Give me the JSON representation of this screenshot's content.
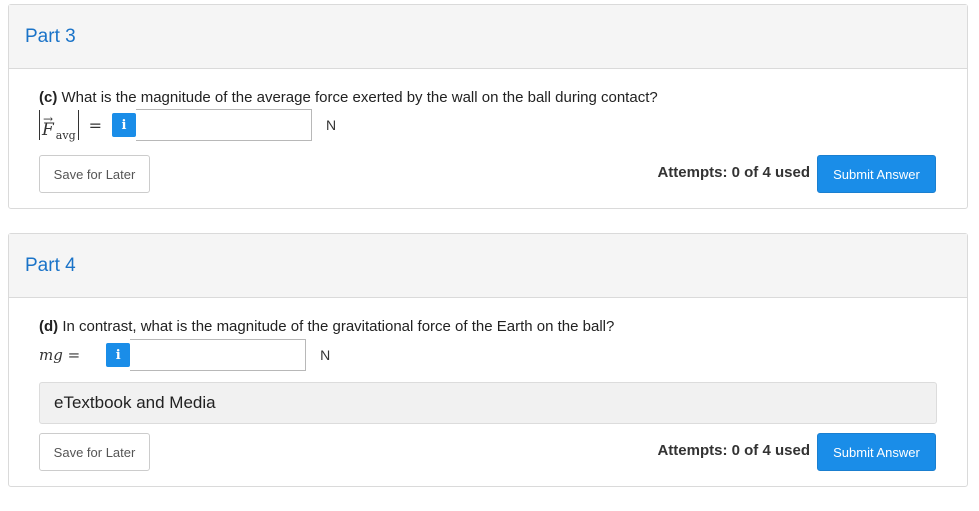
{
  "part3": {
    "title": "Part 3",
    "question_prefix": "(c)",
    "question_text": " What is the magnitude of the average force exerted by the wall on the ball during contact?",
    "var_symbol": "F",
    "var_subscript": "avg",
    "equals": "=",
    "info_icon": "i",
    "input_value": "",
    "unit": "N",
    "save_label": "Save for Later",
    "attempts": "Attempts: 0 of 4 used",
    "submit_label": "Submit Answer"
  },
  "part4": {
    "title": "Part 4",
    "question_prefix": "(d)",
    "question_text": " In contrast, what is the magnitude of the gravitational force of the Earth on the ball?",
    "var_label": "mg =",
    "info_icon": "i",
    "input_value": "",
    "unit": "N",
    "etextbook_label": "eTextbook and Media",
    "save_label": "Save for Later",
    "attempts": "Attempts: 0 of 4 used",
    "submit_label": "Submit Answer"
  }
}
